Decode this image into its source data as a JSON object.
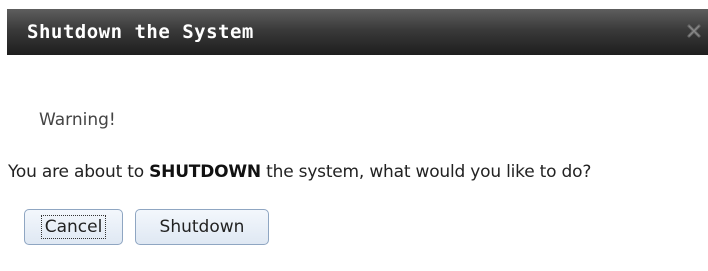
{
  "dialog": {
    "title": "Shutdown the System",
    "close_icon": "close-icon",
    "warning_label": "Warning!",
    "message": {
      "prefix": "You are about to ",
      "emphasis": "SHUTDOWN",
      "suffix": " the system, what would you like to do?"
    },
    "buttons": {
      "cancel_label": "Cancel",
      "shutdown_label": "Shutdown"
    }
  },
  "colors": {
    "titlebar_top": "#5e5e5e",
    "titlebar_bottom": "#1e1e1e",
    "button_border": "#8fa6c2",
    "button_fill": "#dfe8f3"
  }
}
